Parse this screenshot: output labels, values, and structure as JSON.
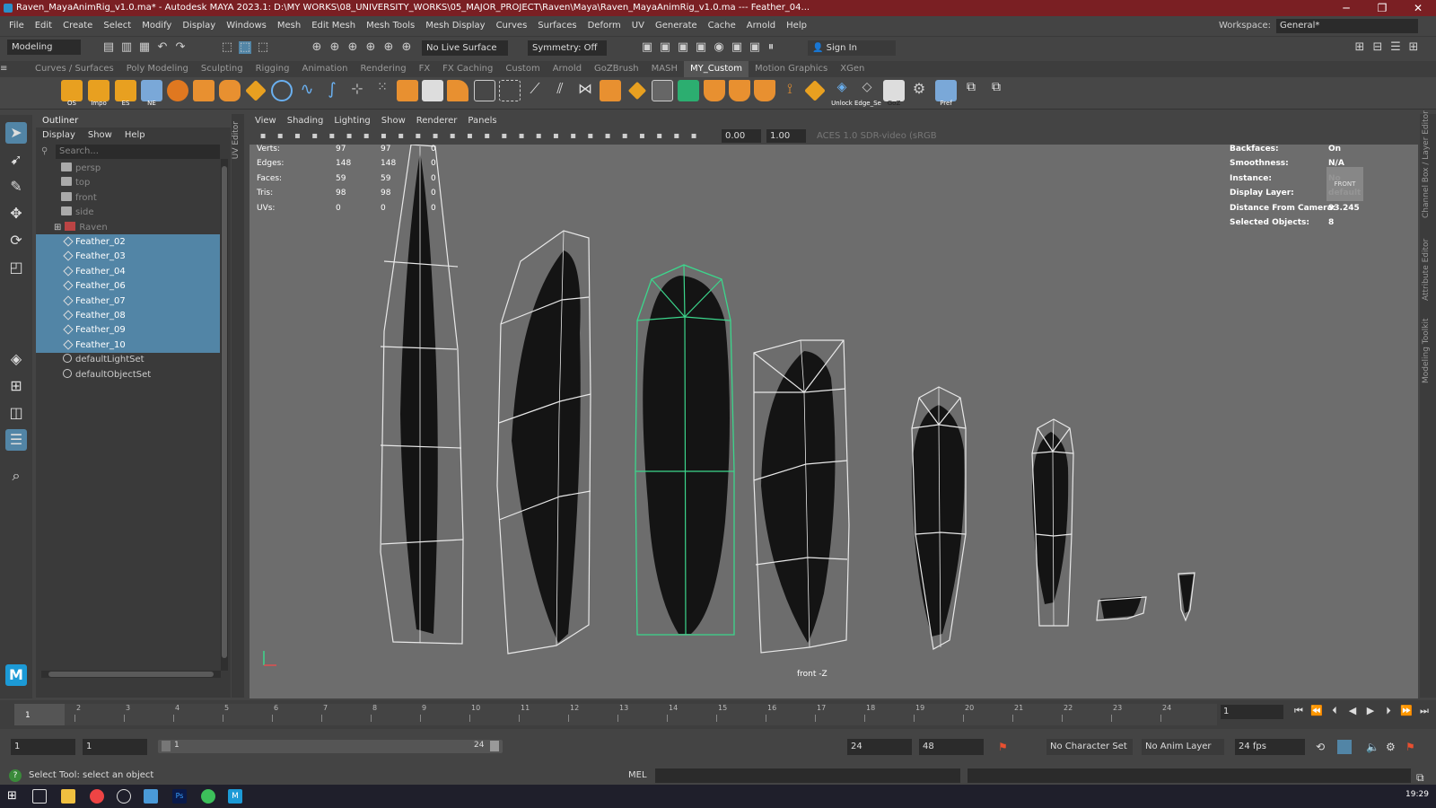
{
  "window": {
    "title": "Raven_MayaAnimRig_v1.0.ma* - Autodesk MAYA 2023.1: D:\\MY WORKS\\08_UNIVERSITY_WORKS\\05_MAJOR_PROJECT\\Raven\\Maya\\Raven_MayaAnimRig_v1.0.ma   ---   Feather_04..."
  },
  "menubar": {
    "items": [
      "File",
      "Edit",
      "Create",
      "Select",
      "Modify",
      "Display",
      "Windows",
      "Mesh",
      "Edit Mesh",
      "Mesh Tools",
      "Mesh Display",
      "Curves",
      "Surfaces",
      "Deform",
      "UV",
      "Generate",
      "Cache",
      "Arnold",
      "Help"
    ],
    "workspace_label": "Workspace:",
    "workspace_value": "General*"
  },
  "statusline": {
    "mode": "Modeling",
    "live_surface": "No Live Surface",
    "symmetry": "Symmetry: Off",
    "signin": "Sign In"
  },
  "shelf": {
    "tabs": [
      "Curves / Surfaces",
      "Poly Modeling",
      "Sculpting",
      "Rigging",
      "Animation",
      "Rendering",
      "FX",
      "FX Caching",
      "Custom",
      "Arnold",
      "GoZBrush",
      "MASH",
      "MY_Custom",
      "Motion Graphics",
      "XGen"
    ],
    "active_tab": "MY_Custom",
    "labels": [
      "OS",
      "Impo",
      "ES",
      "NE",
      "Unlock",
      "Edge_Se",
      "GoZ",
      "Pref"
    ]
  },
  "outliner": {
    "title": "Outliner",
    "menu": [
      "Display",
      "Show",
      "Help"
    ],
    "search_placeholder": "Search...",
    "items": [
      {
        "label": "persp",
        "kind": "camera",
        "selected": false
      },
      {
        "label": "top",
        "kind": "camera",
        "selected": false
      },
      {
        "label": "front",
        "kind": "camera",
        "selected": false
      },
      {
        "label": "side",
        "kind": "camera",
        "selected": false
      },
      {
        "label": "Raven",
        "kind": "group",
        "selected": false
      },
      {
        "label": "Feather_02",
        "kind": "mesh",
        "selected": true
      },
      {
        "label": "Feather_03",
        "kind": "mesh",
        "selected": true
      },
      {
        "label": "Feather_04",
        "kind": "mesh",
        "selected": true
      },
      {
        "label": "Feather_06",
        "kind": "mesh",
        "selected": true
      },
      {
        "label": "Feather_07",
        "kind": "mesh",
        "selected": true
      },
      {
        "label": "Feather_08",
        "kind": "mesh",
        "selected": true
      },
      {
        "label": "Feather_09",
        "kind": "mesh",
        "selected": true
      },
      {
        "label": "Feather_10",
        "kind": "mesh",
        "selected": true
      },
      {
        "label": "defaultLightSet",
        "kind": "set",
        "selected": false
      },
      {
        "label": "defaultObjectSet",
        "kind": "set",
        "selected": false
      }
    ]
  },
  "uv_editor_label": "UV Editor",
  "viewport": {
    "menu": [
      "View",
      "Shading",
      "Lighting",
      "Show",
      "Renderer",
      "Panels"
    ],
    "exposure": "0.00",
    "gamma": "1.00",
    "colorspace": "ACES 1.0 SDR-video (sRGB",
    "hud_left": [
      {
        "label": "Verts:",
        "a": "97",
        "b": "97",
        "c": "0"
      },
      {
        "label": "Edges:",
        "a": "148",
        "b": "148",
        "c": "0"
      },
      {
        "label": "Faces:",
        "a": "59",
        "b": "59",
        "c": "0"
      },
      {
        "label": "Tris:",
        "a": "98",
        "b": "98",
        "c": "0"
      },
      {
        "label": "UVs:",
        "a": "0",
        "b": "0",
        "c": "0"
      }
    ],
    "hud_right": [
      {
        "label": "Backfaces:",
        "value": "On"
      },
      {
        "label": "Smoothness:",
        "value": "N/A"
      },
      {
        "label": "Instance:",
        "value": "No"
      },
      {
        "label": "Display Layer:",
        "value": "default"
      },
      {
        "label": "Distance From Camera:",
        "value": "93.245"
      },
      {
        "label": "Selected Objects:",
        "value": "8"
      }
    ],
    "view_cube": "FRONT",
    "camera": "front -Z"
  },
  "right_panels": [
    "Channel Box / Layer Editor",
    "Attribute Editor",
    "Modeling Toolkit"
  ],
  "timeline": {
    "ticks": [
      "1",
      "2",
      "3",
      "4",
      "5",
      "6",
      "7",
      "8",
      "9",
      "10",
      "11",
      "12",
      "13",
      "14",
      "15",
      "16",
      "17",
      "18",
      "19",
      "20",
      "21",
      "22",
      "23",
      "24"
    ],
    "current": "1",
    "current_frame_field": "1"
  },
  "range": {
    "start": "1",
    "start2": "1",
    "slider_start": "1",
    "slider_end": "24",
    "end": "24",
    "end2": "48",
    "character_set": "No Character Set",
    "anim_layer": "No Anim Layer",
    "fps": "24 fps"
  },
  "helpline": {
    "text": "Select Tool: select an object",
    "mel": "MEL"
  },
  "taskbar": {
    "clock": "19:29"
  },
  "colors": {
    "title_bg": "#7a1f23",
    "selection": "#5285a6",
    "selected_wire": "#3cd68c",
    "viewport_bg": "#6d6d6d"
  }
}
